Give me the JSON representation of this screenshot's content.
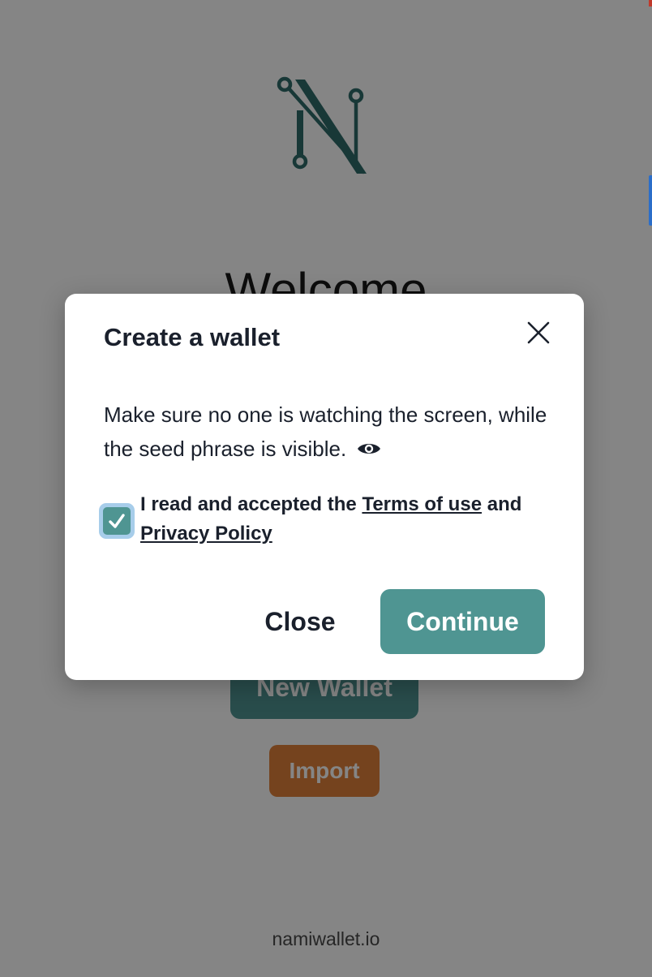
{
  "background": {
    "welcome_title": "Welcome",
    "new_wallet_label": "New Wallet",
    "import_label": "Import",
    "footer_link": "namiwallet.io"
  },
  "modal": {
    "title": "Create a wallet",
    "message": "Make sure no one is watching the screen, while the seed phrase is visible.",
    "checkbox": {
      "checked": true,
      "prefix": "I read and accepted the",
      "terms_link": "Terms of use",
      "conjunction": "and",
      "privacy_link": "Privacy Policy"
    },
    "close_label": "Close",
    "continue_label": "Continue"
  },
  "icons": {
    "logo": "nami-logo-icon",
    "close": "close-icon",
    "eye": "eye-icon",
    "check": "check-icon"
  },
  "colors": {
    "brand_teal": "#4f9592",
    "import_orange": "#e0803a",
    "text_dark": "#1a202c",
    "checkbox_ring": "#a7cdea"
  }
}
